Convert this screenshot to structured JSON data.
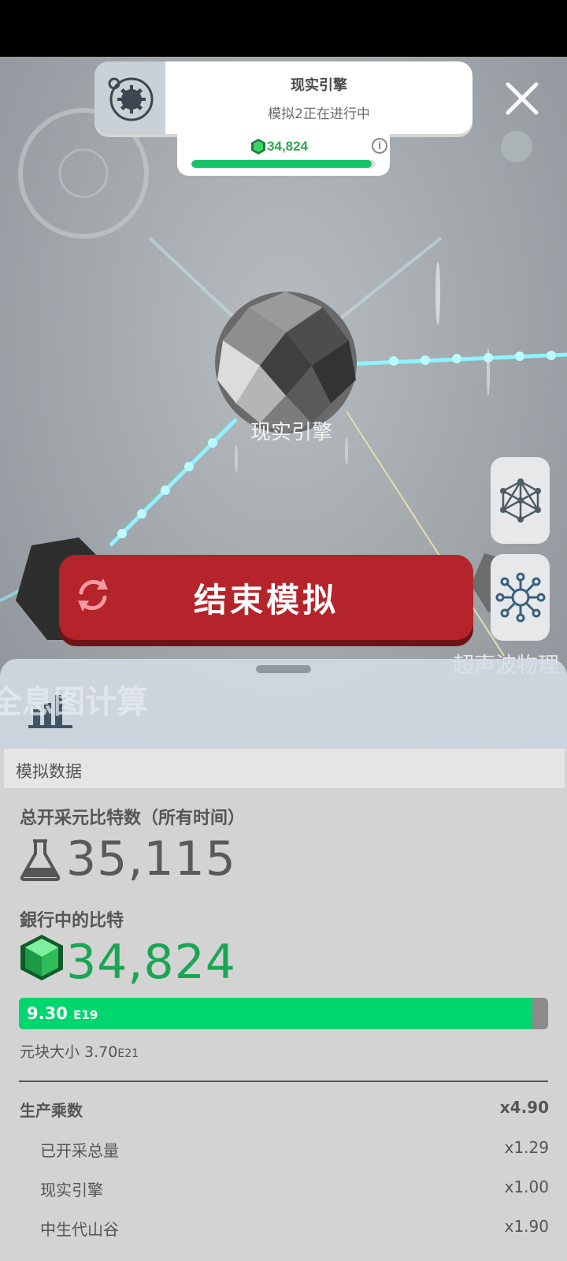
{
  "notification": {
    "title": "现实引擎",
    "subtitle": "模拟2正在进行中"
  },
  "bits_panel": {
    "value": "34,824",
    "info_symbol": "i",
    "progress": 0.98
  },
  "scene": {
    "center_node_label": "现实引擎",
    "right_node_label": "超声波物理",
    "left_node_label": "全息图计算"
  },
  "end_button": {
    "label": "结束模拟"
  },
  "icons": {
    "notification": "gear-planet-icon",
    "close": "close-icon",
    "side_top": "molecule-structure-icon",
    "side_bottom": "network-hub-icon",
    "end": "sync-icon",
    "stats": "bar-chart-icon",
    "flask": "flask-icon",
    "gem": "green-gem-icon"
  },
  "colors": {
    "accent_green": "#18c36a",
    "end_button_red": "#b4242a",
    "value_green": "#18a653"
  },
  "sheet": {
    "title": "模拟数据",
    "total_label": "总开采元比特数（所有时间）",
    "total_value": "35,115",
    "bank_label": "銀行中的比特",
    "bank_value": "34,824",
    "progress_value": "9.30",
    "progress_exp": "E19",
    "progress_fraction": 0.97,
    "block_size_label": "元块大小 3.70",
    "block_size_exp": "E21",
    "multiplier_label": "生产乘数",
    "multiplier_value": "x4.90",
    "sub_rows": [
      {
        "label": "已开采总量",
        "value": "x1.29"
      },
      {
        "label": "现实引擎",
        "value": "x1.00"
      },
      {
        "label": "中生代山谷",
        "value": "x1.90"
      }
    ]
  }
}
